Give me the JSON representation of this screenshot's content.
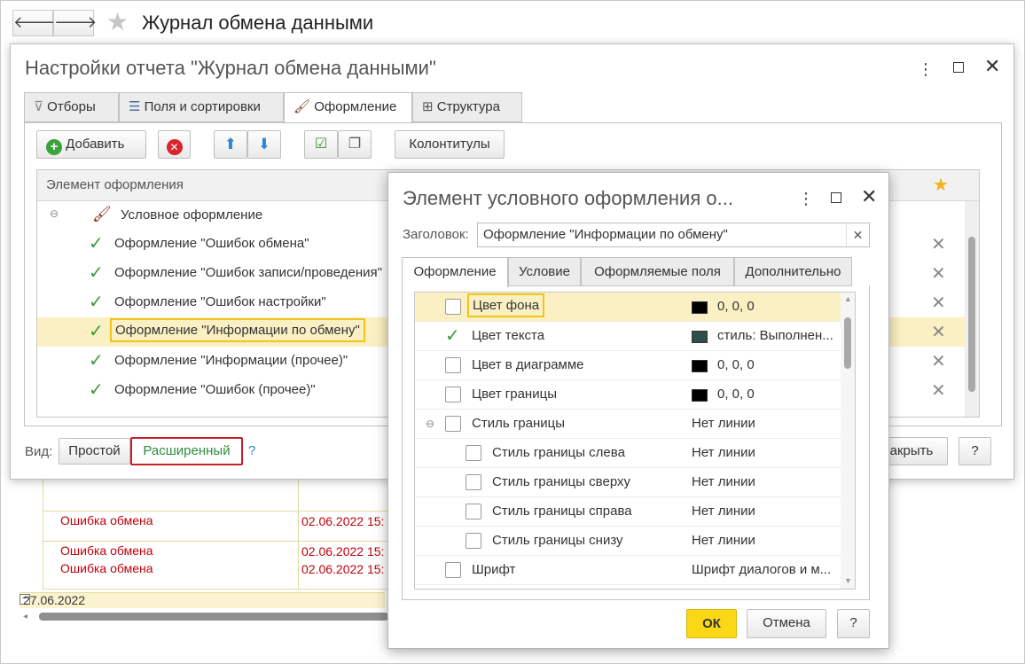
{
  "header": {
    "back": "🡐",
    "forward": "🡒",
    "title": "Журнал обмена данными"
  },
  "background_report": {
    "rows": [
      {
        "type": "Ошибка обмена",
        "date": "02.06.2022 15:"
      },
      {
        "type": "Ошибка обмена",
        "date": "02.06.2022 15:"
      },
      {
        "type": "Ошибка обмена",
        "date": "02.06.2022 15:"
      }
    ],
    "group_date": "27.06.2022"
  },
  "settings": {
    "title": "Настройки отчета \"Журнал обмена данными\"",
    "tabs": [
      "Отборы",
      "Поля и сортировки",
      "Оформление",
      "Структура"
    ],
    "toolbar": {
      "add": "Добавить",
      "headers_footers": "Колонтитулы"
    },
    "grid_header": "Элемент оформления",
    "group": "Условное оформление",
    "items": [
      "Оформление \"Ошибок обмена\"",
      "Оформление \"Ошибок записи/проведения\"",
      "Оформление \"Ошибок настройки\"",
      "Оформление \"Информации по обмену\"",
      "Оформление \"Информации (прочее)\"",
      "Оформление \"Ошибок (прочее)\""
    ],
    "view_label": "Вид:",
    "view_simple": "Простой",
    "view_extended": "Расширенный",
    "help": "?",
    "close_label": "акрыть"
  },
  "dialog": {
    "title": "Элемент условного оформления о...",
    "caption_label": "Заголовок:",
    "caption_value": "Оформление \"Информации по обмену\"",
    "tabs": [
      "Оформление",
      "Условие",
      "Оформляемые поля",
      "Дополнительно"
    ],
    "rows": [
      {
        "label": "Цвет фона",
        "value": "0, 0, 0"
      },
      {
        "label": "Цвет текста",
        "value": "стиль: Выполнен..."
      },
      {
        "label": "Цвет в диаграмме",
        "value": "0, 0, 0"
      },
      {
        "label": "Цвет границы",
        "value": "0, 0, 0"
      },
      {
        "label": "Стиль границы",
        "value": "Нет линии"
      },
      {
        "label": "Стиль границы слева",
        "value": "Нет линии"
      },
      {
        "label": "Стиль границы сверху",
        "value": "Нет линии"
      },
      {
        "label": "Стиль границы справа",
        "value": "Нет линии"
      },
      {
        "label": "Стиль границы снизу",
        "value": "Нет линии"
      },
      {
        "label": "Шрифт",
        "value": "Шрифт диалогов и м..."
      }
    ],
    "ok": "ОК",
    "cancel": "Отмена",
    "help": "?"
  },
  "colors": {
    "accent_yellow": "#fbd816",
    "selected_row": "#fbf0c3",
    "highlight_border": "#f0c419",
    "red_border": "#c8202a",
    "green_text": "#2e8b3e",
    "error_red": "#c0000a"
  }
}
